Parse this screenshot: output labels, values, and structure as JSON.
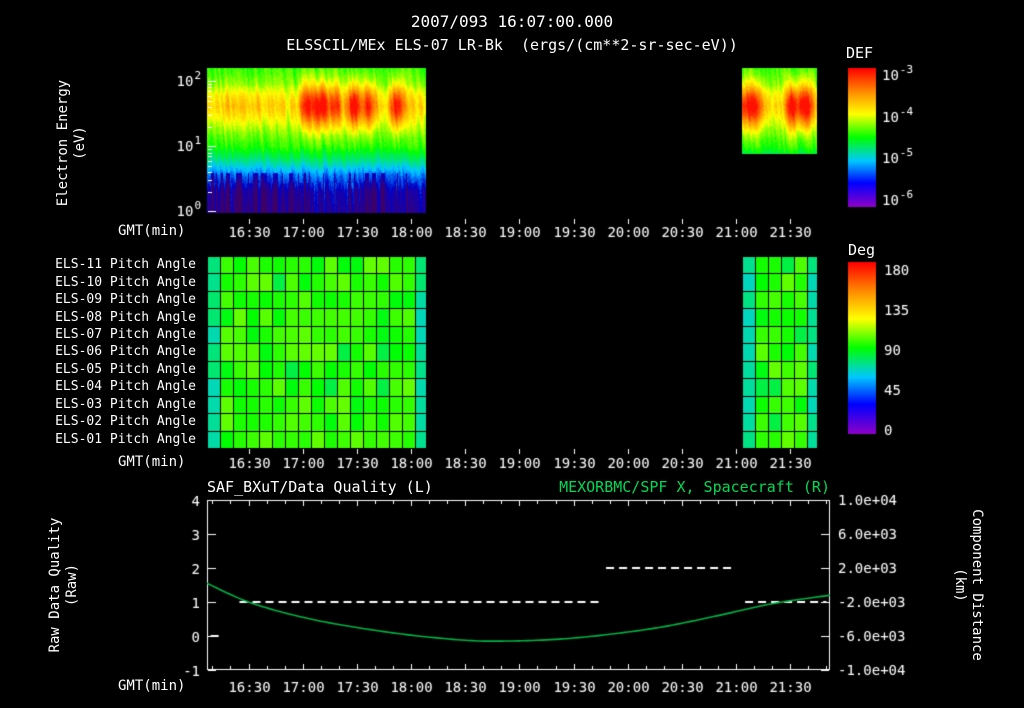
{
  "header": {
    "title": "2007/093 16:07:00.000",
    "subtitle": "ELSSCIL/MEx ELS-07 LR-Bk  (ergs/(cm**2-sr-sec-eV))"
  },
  "colors": {
    "background": "#000000",
    "text": "#ffffff",
    "green_title": "#00d955",
    "curve_green": "#00b347"
  },
  "time_axis": {
    "label": "GMT(min)",
    "start_min": 7,
    "end_min": 352,
    "minor_step_min": 10,
    "ticks": [
      {
        "min": 30,
        "label": "16:30"
      },
      {
        "min": 60,
        "label": "17:00"
      },
      {
        "min": 90,
        "label": "17:30"
      },
      {
        "min": 120,
        "label": "18:00"
      },
      {
        "min": 150,
        "label": "18:30"
      },
      {
        "min": 180,
        "label": "19:00"
      },
      {
        "min": 210,
        "label": "19:30"
      },
      {
        "min": 240,
        "label": "20:00"
      },
      {
        "min": 270,
        "label": "20:30"
      },
      {
        "min": 300,
        "label": "21:00"
      },
      {
        "min": 330,
        "label": "21:30"
      }
    ]
  },
  "chart_data": [
    {
      "id": "electron_energy_spectrogram",
      "type": "heatmap",
      "ylabel_lines": [
        "Electron Energy",
        "(eV)"
      ],
      "yscale": "log",
      "ylim_ev": [
        1,
        200
      ],
      "yticks": [
        {
          "base": "10",
          "exp": "2",
          "value_ev": 100
        },
        {
          "base": "10",
          "exp": "1",
          "value_ev": 10
        },
        {
          "base": "10",
          "exp": "0",
          "value_ev": 1
        }
      ],
      "colorbar": {
        "title": "DEF",
        "units": "ergs/(cm**2-sr-sec-eV)",
        "scale": "log",
        "ticks": [
          {
            "base": "10",
            "exp": "-3"
          },
          {
            "base": "10",
            "exp": "-4"
          },
          {
            "base": "10",
            "exp": "-5"
          },
          {
            "base": "10",
            "exp": "-6"
          }
        ]
      },
      "data_blocks": [
        {
          "start_min": 7,
          "end_min": 128,
          "energy_min_ev": 1,
          "energy_max_ev": 200,
          "enhanced_times_min": [
            63,
            70,
            78,
            88,
            96,
            112
          ]
        },
        {
          "start_min": 303,
          "end_min": 345,
          "energy_min_ev": 8,
          "energy_max_ev": 200,
          "enhanced_times_min": [
            306,
            312,
            332,
            339
          ]
        }
      ],
      "flux_summary": [
        {
          "energy_ev_range": [
            1,
            3
          ],
          "approx_flux": "1e-6 to 4e-6"
        },
        {
          "energy_ev_range": [
            3,
            8
          ],
          "approx_flux": "~1e-5"
        },
        {
          "energy_ev_range": [
            8,
            20
          ],
          "approx_flux": "~4e-5"
        },
        {
          "energy_ev_range": [
            20,
            90
          ],
          "approx_flux": "1e-4 to 1e-3 (peak band, red patches 17:05-17:40 and 21:05-21:40)"
        },
        {
          "energy_ev_range": [
            90,
            200
          ],
          "approx_flux": "~5e-5"
        }
      ]
    },
    {
      "id": "pitch_angle_panels",
      "type": "heatmap",
      "rows": [
        "ELS-11 Pitch Angle",
        "ELS-10 Pitch Angle",
        "ELS-09 Pitch Angle",
        "ELS-08 Pitch Angle",
        "ELS-07 Pitch Angle",
        "ELS-06 Pitch Angle",
        "ELS-05 Pitch Angle",
        "ELS-04 Pitch Angle",
        "ELS-03 Pitch Angle",
        "ELS-02 Pitch Angle",
        "ELS-01 Pitch Angle"
      ],
      "colorbar": {
        "title": "Deg",
        "ticks": [
          180,
          135,
          90,
          45,
          0
        ]
      },
      "data_blocks": [
        {
          "start_min": 7,
          "end_min": 128
        },
        {
          "start_min": 303,
          "end_min": 345
        }
      ],
      "typical_value_deg": 95,
      "edge_value_deg": 72
    },
    {
      "id": "quality_and_spacecraft_position",
      "type": "line",
      "title_left": "SAF_BXuT/Data Quality (L)",
      "title_right": "MEXORBMC/SPF X, Spacecraft (R)",
      "left_axis": {
        "label_lines": [
          "Raw Data Quality",
          "(Raw)"
        ],
        "lim": [
          -1,
          4
        ],
        "ticks": [
          4,
          3,
          2,
          1,
          0,
          -1
        ]
      },
      "right_axis": {
        "label_lines": [
          "Component Distance",
          "(km)"
        ],
        "lim": [
          -10000,
          10000
        ],
        "tick_labels": [
          "1.0e+04",
          "6.0e+03",
          "2.0e+03",
          "-2.0e+03",
          "-6.0e+03",
          "-1.0e+04"
        ]
      },
      "series": [
        {
          "name": "MEXORBMC/SPF X Spacecraft",
          "axis": "right",
          "style": "solid",
          "color_key": "curve_green",
          "points": [
            [
              7,
              200
            ],
            [
              30,
              -2000
            ],
            [
              60,
              -3800
            ],
            [
              90,
              -5000
            ],
            [
              120,
              -5900
            ],
            [
              150,
              -6500
            ],
            [
              170,
              -6600
            ],
            [
              200,
              -6400
            ],
            [
              230,
              -5800
            ],
            [
              260,
              -4900
            ],
            [
              290,
              -3600
            ],
            [
              320,
              -2200
            ],
            [
              352,
              -1200
            ]
          ]
        },
        {
          "name": "SAF_BXuT Data Quality",
          "axis": "left",
          "style": "dashed",
          "color_key": "text",
          "segments": [
            {
              "value": 0,
              "start_min": 9,
              "end_min": 14
            },
            {
              "value": 1,
              "start_min": 25,
              "end_min": 225
            },
            {
              "value": 2,
              "start_min": 228,
              "end_min": 300
            },
            {
              "value": 1,
              "start_min": 305,
              "end_min": 350
            }
          ]
        }
      ]
    }
  ]
}
